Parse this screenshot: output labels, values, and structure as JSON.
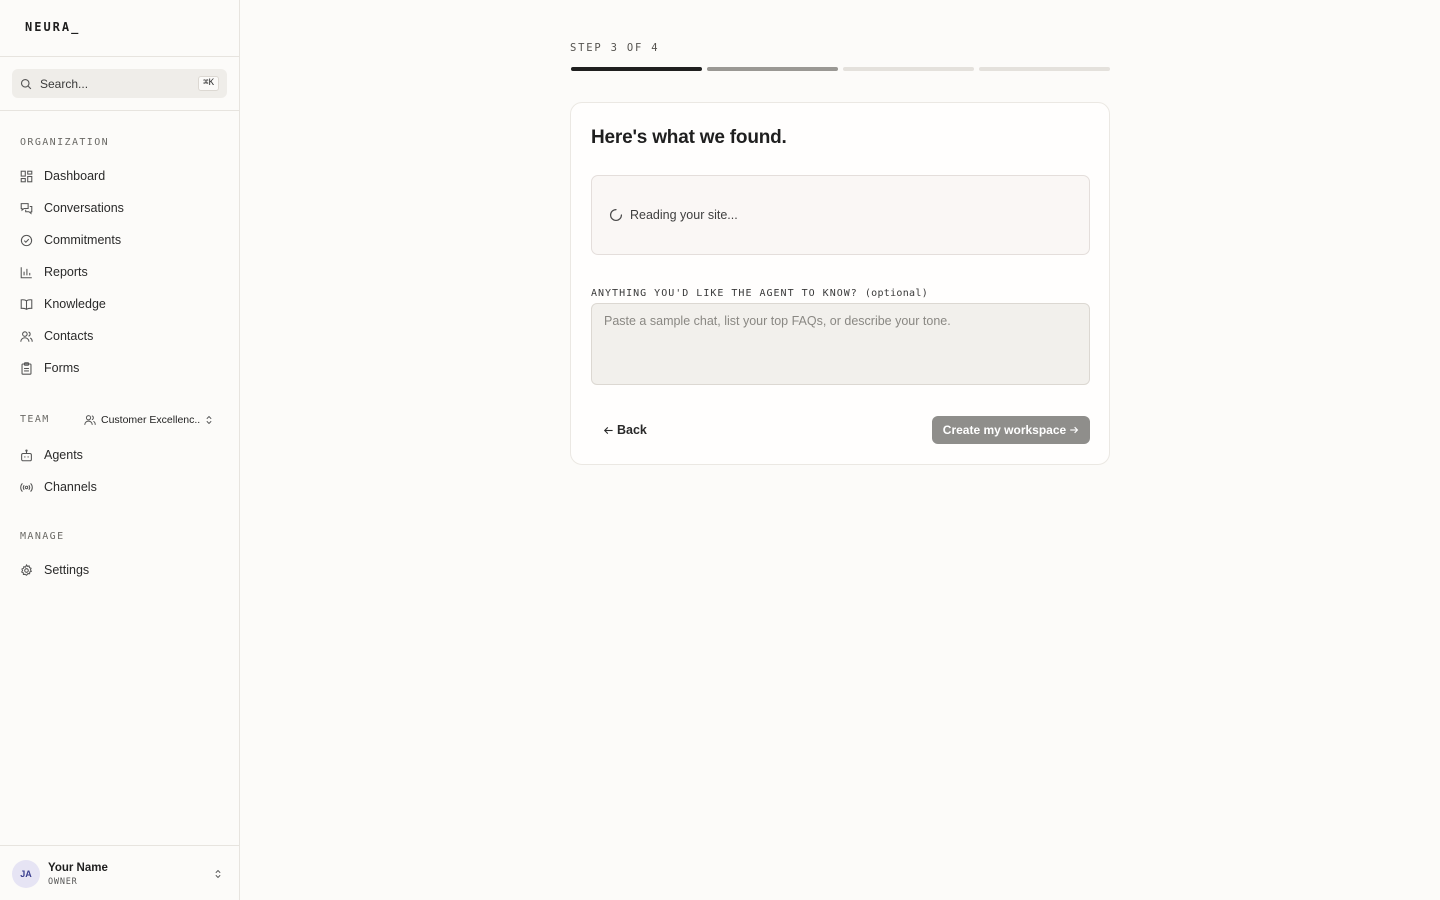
{
  "brand": {
    "name": "NEURA_"
  },
  "search": {
    "placeholder": "Search...",
    "shortcut": "⌘K"
  },
  "sidebar": {
    "organization_label": "ORGANIZATION",
    "organization_items": [
      {
        "label": "Dashboard",
        "icon": "dashboard-icon"
      },
      {
        "label": "Conversations",
        "icon": "conversations-icon"
      },
      {
        "label": "Commitments",
        "icon": "check-circle-icon"
      },
      {
        "label": "Reports",
        "icon": "bar-chart-icon"
      },
      {
        "label": "Knowledge",
        "icon": "book-icon"
      },
      {
        "label": "Contacts",
        "icon": "users-icon"
      },
      {
        "label": "Forms",
        "icon": "clipboard-icon"
      }
    ],
    "team_label": "TEAM",
    "team_selector": {
      "value": "Customer Excellenc...",
      "icon": "users-icon"
    },
    "team_items": [
      {
        "label": "Agents",
        "icon": "bot-icon"
      },
      {
        "label": "Channels",
        "icon": "broadcast-icon"
      }
    ],
    "manage_label": "MANAGE",
    "manage_items": [
      {
        "label": "Settings",
        "icon": "gear-icon"
      }
    ]
  },
  "user": {
    "initials": "JA",
    "name": "Your Name",
    "role": "OWNER"
  },
  "wizard": {
    "step_label": "STEP 3 OF 4",
    "progress": {
      "current_step": 3,
      "total_steps": 4
    },
    "colors": {
      "complete": "#1f1f1f",
      "active": "#9a9894",
      "pending": "#e4e1dc"
    }
  },
  "card": {
    "title": "Here's what we found.",
    "status_text": "Reading your site...",
    "field_label": "ANYTHING YOU'D LIKE THE AGENT TO KNOW?",
    "field_optional": "(optional)",
    "textarea_placeholder": "Paste a sample chat, list your top FAQs, or describe your tone.",
    "textarea_value": "",
    "back_label": "Back",
    "create_label": "Create my workspace"
  }
}
